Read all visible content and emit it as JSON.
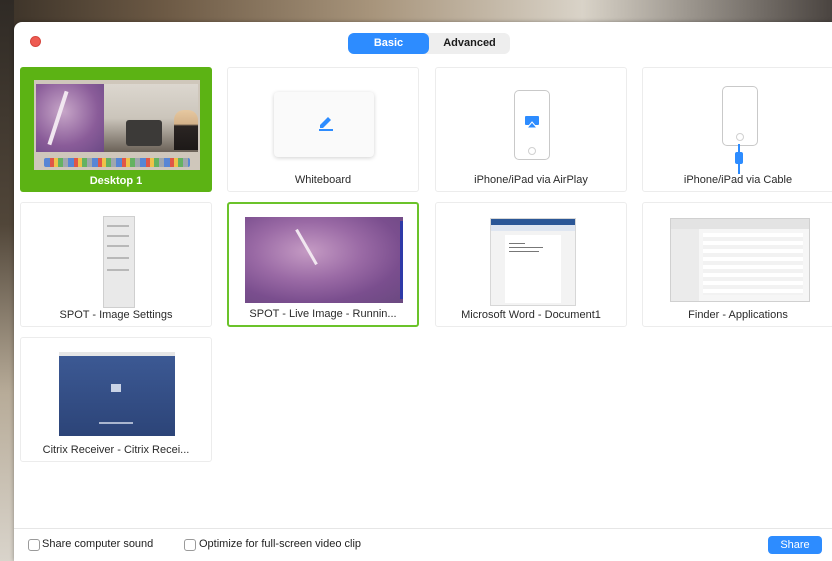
{
  "tabs": [
    {
      "label": "Basic",
      "active": true
    },
    {
      "label": "Advanced",
      "active": false
    }
  ],
  "tiles": [
    {
      "caption": "Desktop 1",
      "state": "selected",
      "kind": "desktop"
    },
    {
      "caption": "Whiteboard",
      "state": "normal",
      "kind": "whiteboard"
    },
    {
      "caption": "iPhone/iPad via AirPlay",
      "state": "normal",
      "kind": "airplay"
    },
    {
      "caption": "iPhone/iPad via Cable",
      "state": "normal",
      "kind": "cable"
    },
    {
      "caption": "SPOT - Image Settings",
      "state": "normal",
      "kind": "window"
    },
    {
      "caption": "SPOT - Live Image - Runnin...",
      "state": "hover",
      "kind": "window"
    },
    {
      "caption": "Microsoft Word - Document1",
      "state": "normal",
      "kind": "window"
    },
    {
      "caption": "Finder - Applications",
      "state": "normal",
      "kind": "window"
    },
    {
      "caption": "Citrix Receiver - Citrix Recei...",
      "state": "normal",
      "kind": "window"
    }
  ],
  "options": {
    "share_sound": {
      "label": "Share computer sound",
      "checked": false
    },
    "optimize_video": {
      "label": "Optimize for full-screen video clip",
      "checked": false
    }
  },
  "share_button": "Share",
  "colors": {
    "accent": "#2d8cff",
    "selected_tile": "#5cb314",
    "hover_border": "#6bc32a",
    "close": "#ee5b52"
  },
  "icons": {
    "whiteboard": "pencil-icon",
    "airplay": "airplay-icon",
    "cable": "lightning-cable-icon"
  }
}
